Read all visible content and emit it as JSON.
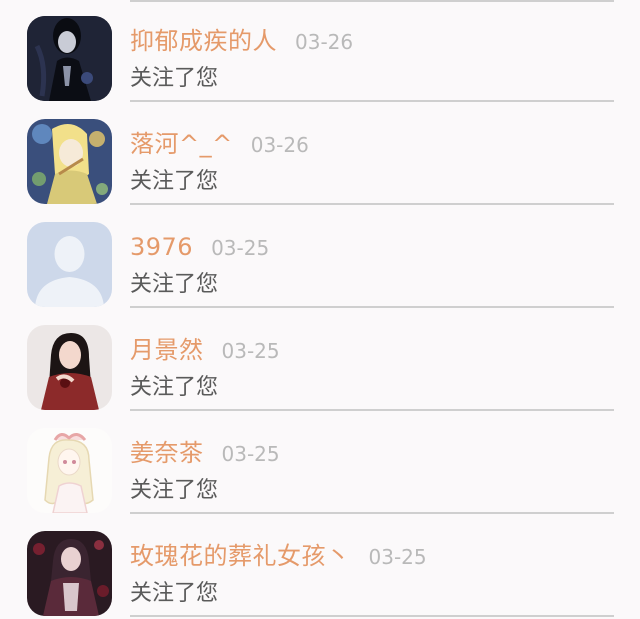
{
  "notifications": [
    {
      "name": "抑郁成疾的人",
      "time": "03-26",
      "action": "关注了您",
      "avatar": "dark-figure-avatar"
    },
    {
      "name": "落河^_^",
      "time": "03-26",
      "action": "关注了您",
      "avatar": "anime-girl-avatar"
    },
    {
      "name": "3976",
      "time": "03-25",
      "action": "关注了您",
      "avatar": "default-user-avatar"
    },
    {
      "name": "月景然",
      "time": "03-25",
      "action": "关注了您",
      "avatar": "photo-woman-avatar"
    },
    {
      "name": "姜奈茶",
      "time": "03-25",
      "action": "关注了您",
      "avatar": "sketch-girl-avatar"
    },
    {
      "name": "玫瑰花的葬礼女孩丶",
      "time": "03-25",
      "action": "关注了您",
      "avatar": "gothic-girl-avatar"
    }
  ]
}
